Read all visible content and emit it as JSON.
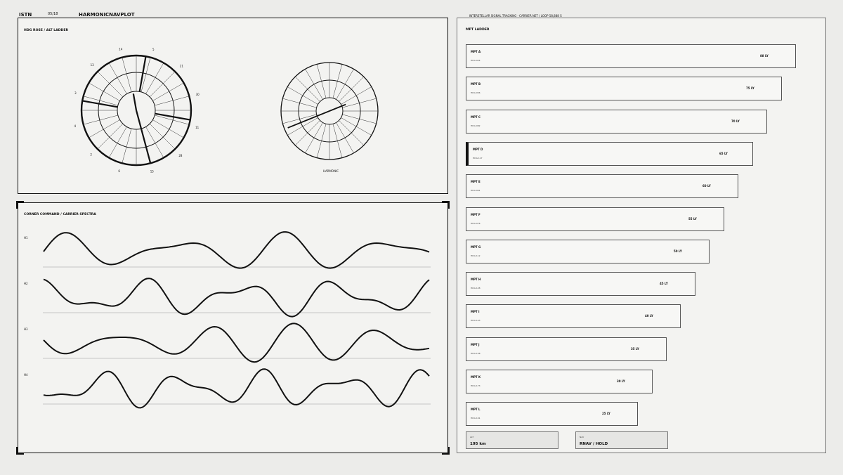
{
  "header": {
    "brand": "ISTN",
    "page": "05/18",
    "title": "HARMONICNAVPLOT"
  },
  "status": {
    "line": "INTERSTELLAR SIGNAL TRACKING · CARRIER NET / LOOP 58,888 S"
  },
  "rose_panel": {
    "title": "HDG ROSE / ALT LADDER",
    "rose_labels": [
      "14",
      "5",
      "21",
      "30",
      "11",
      "28",
      "15",
      "6",
      "2",
      "4",
      "3",
      "13"
    ],
    "dial_caption": "HARMONIC"
  },
  "spectra_panel": {
    "title": "CORNER COMMAND / CARRIER SPECTRA",
    "rows": [
      {
        "label": "H1",
        "phase": 0.0,
        "f1": 0.9,
        "f2": 1.3
      },
      {
        "label": "H2",
        "phase": 1.3,
        "f1": 1.0,
        "f2": 1.7
      },
      {
        "label": "H3",
        "phase": 2.4,
        "f1": 1.1,
        "f2": 1.4
      },
      {
        "label": "H4",
        "phase": 3.3,
        "f1": 1.2,
        "f2": 1.9
      }
    ]
  },
  "ladder_panel": {
    "title": "MPT LADDER",
    "items": [
      {
        "name": "MPT A",
        "code": "HDG 024",
        "value": "88 LY",
        "fraction": 1.0
      },
      {
        "name": "MPT B",
        "code": "HDG 056",
        "value": "75 LY",
        "fraction": 0.957
      },
      {
        "name": "MPT C",
        "code": "HDG 082",
        "value": "70 LY",
        "fraction": 0.913
      },
      {
        "name": "MPT D",
        "code": "HDG 117",
        "value": "65 LY",
        "fraction": 0.87,
        "selected": true
      },
      {
        "name": "MPT E",
        "code": "HDG 061",
        "value": "60 LY",
        "fraction": 0.826
      },
      {
        "name": "MPT F",
        "code": "HDG 076",
        "value": "55 LY",
        "fraction": 0.783
      },
      {
        "name": "MPT G",
        "code": "HDG 112",
        "value": "50 LY",
        "fraction": 0.739
      },
      {
        "name": "MPT H",
        "code": "HDG 128",
        "value": "45 LY",
        "fraction": 0.696
      },
      {
        "name": "MPT I",
        "code": "HDG 143",
        "value": "40 LY",
        "fraction": 0.652
      },
      {
        "name": "MPT J",
        "code": "HDG 158",
        "value": "35 LY",
        "fraction": 0.609
      },
      {
        "name": "MPT K",
        "code": "HDG 173",
        "value": "30 LY",
        "fraction": 0.565
      },
      {
        "name": "MPT L",
        "code": "HDG 191",
        "value": "25 LY",
        "fraction": 0.522
      }
    ],
    "alt": {
      "key": "ALT",
      "value": "195 km"
    },
    "mode": {
      "key": "NAV",
      "value": "RNAV / HOLD"
    }
  },
  "colors": {
    "ink": "#111111",
    "paper": "#f3f3f1",
    "background": "#ececea"
  }
}
